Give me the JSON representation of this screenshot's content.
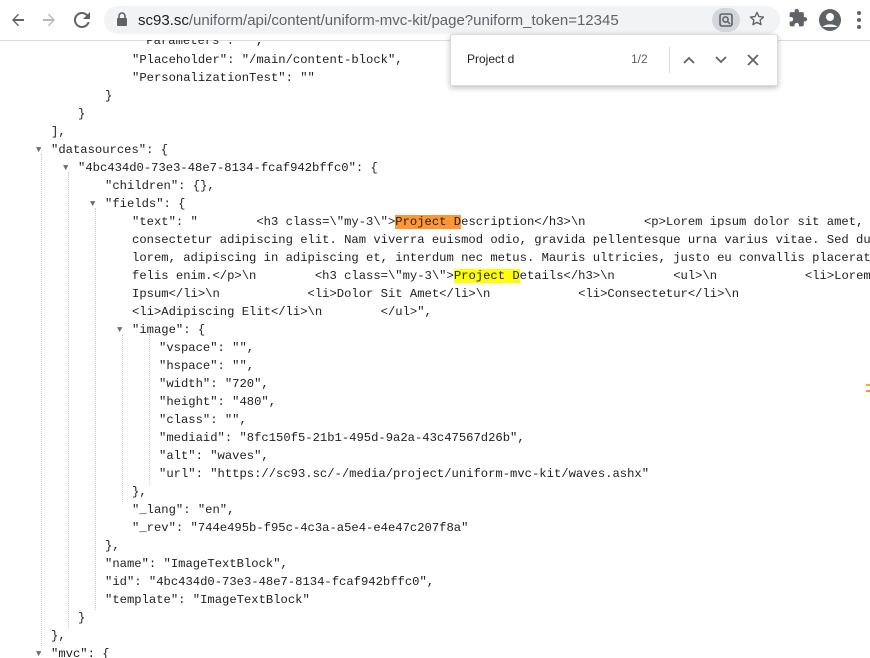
{
  "browser": {
    "url_host": "sc93.sc",
    "url_path": "/uniform/api/content/uniform-mvc-kit/page?uniform_token=12345",
    "icons": [
      "back-icon",
      "forward-icon",
      "reload-icon",
      "lock-icon",
      "lens-icon",
      "star-icon",
      "extensions-icon",
      "profile-icon",
      "menu-icon"
    ]
  },
  "find": {
    "query": "Project d",
    "count": "1/2"
  },
  "lines": {
    "l01": "\"Parameters\": \"\",",
    "l02": "\"Placeholder\": \"/main/content-block\",",
    "l03": "\"PersonalizationTest\": \"\"",
    "l04": "}",
    "l05": "],",
    "l06": "\"datasources\": {",
    "l07": "\"4bc434d0-73e3-48e7-8134-fcaf942bffc0\": {",
    "l08": "\"children\": {},",
    "l09": "\"fields\": {",
    "l10a": "\"text\": \"        <h3 class=\\\"my-3\\\">",
    "l10m": "Project D",
    "l10b": "escription</h3>\\n        <p>Lorem ipsum dolor sit amet,",
    "l11": "consectetur adipiscing elit. Nam viverra euismod odio, gravida pellentesque urna varius vitae. Sed dui",
    "l12": "lorem, adipiscing in adipiscing et, interdum nec metus. Mauris ultricies, justo eu convallis placerat,",
    "l13a": "felis enim.</p>\\n        <h3 class=\\\"my-3\\\">",
    "l13m": "Project D",
    "l13b": "etails</h3>\\n        <ul>\\n            <li>Lorem",
    "l14": "Ipsum</li>\\n            <li>Dolor Sit Amet</li>\\n            <li>Consectetur</li>\\n",
    "l15": "<li>Adipiscing Elit</li>\\n        </ul>\",",
    "l16": "\"image\": {",
    "l17": "\"vspace\": \"\",",
    "l18": "\"hspace\": \"\",",
    "l19": "\"width\": \"720\",",
    "l20": "\"height\": \"480\",",
    "l21": "\"class\": \"\",",
    "l22": "\"mediaid\": \"8fc150f5-21b1-495d-9a2a-43c47567d26b\",",
    "l23": "\"alt\": \"waves\",",
    "l24": "\"url\": \"https://sc93.sc/-/media/project/uniform-mvc-kit/waves.ashx\"",
    "l25": "},",
    "l26": "\"_lang\": \"en\",",
    "l27": "\"_rev\": \"744e495b-f95c-4c3a-a5e4-e4e47c207f8a\"",
    "l28": "},",
    "l29": "\"name\": \"ImageTextBlock\",",
    "l30": "\"id\": \"4bc434d0-73e3-48e7-8134-fcaf942bffc0\",",
    "l31": "\"template\": \"ImageTextBlock\"",
    "l32": "}",
    "l33": "},",
    "l34": "\"mvc\": {"
  },
  "colors": {
    "current_match": "#ff9632",
    "other_match": "#ffff00",
    "string": "#1a1aa6"
  }
}
